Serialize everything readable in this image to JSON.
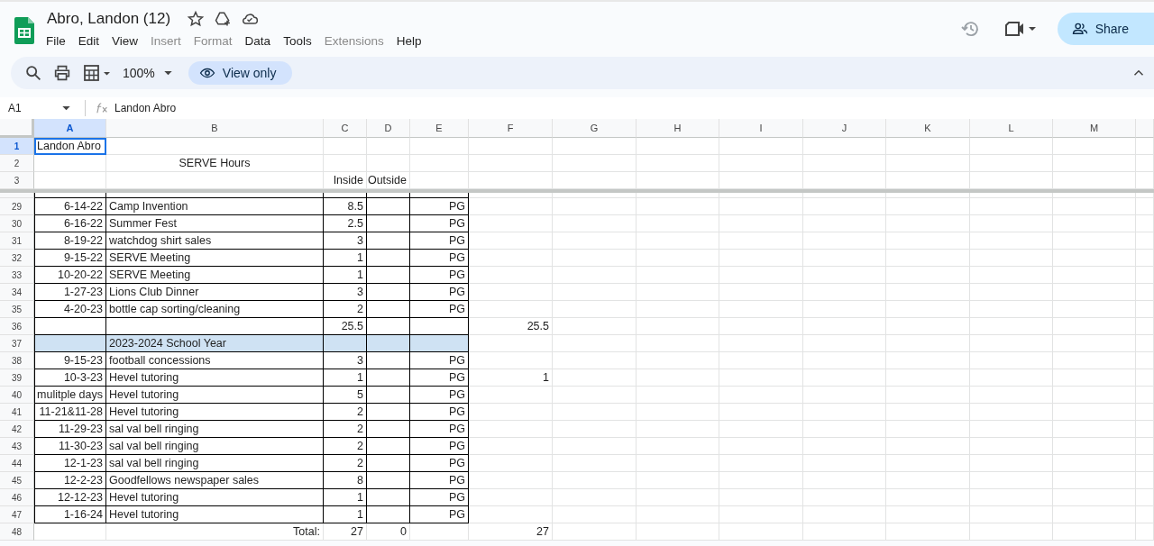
{
  "document": {
    "title": "Abro, Landon (12)"
  },
  "menus": [
    {
      "label": "File",
      "disabled": false
    },
    {
      "label": "Edit",
      "disabled": false
    },
    {
      "label": "View",
      "disabled": false
    },
    {
      "label": "Insert",
      "disabled": true
    },
    {
      "label": "Format",
      "disabled": true
    },
    {
      "label": "Data",
      "disabled": false
    },
    {
      "label": "Tools",
      "disabled": false
    },
    {
      "label": "Extensions",
      "disabled": true
    },
    {
      "label": "Help",
      "disabled": false
    }
  ],
  "share_button": {
    "label": "Share"
  },
  "toolbar": {
    "zoom": "100%",
    "mode": "View only"
  },
  "formula_bar": {
    "name_box": "A1",
    "value": "Landon Abro"
  },
  "columns": [
    {
      "label": "A",
      "selected": true
    },
    {
      "label": "B",
      "selected": false
    },
    {
      "label": "C",
      "selected": false
    },
    {
      "label": "D",
      "selected": false
    },
    {
      "label": "E",
      "selected": false
    },
    {
      "label": "F",
      "selected": false
    },
    {
      "label": "G",
      "selected": false
    },
    {
      "label": "H",
      "selected": false
    },
    {
      "label": "I",
      "selected": false
    },
    {
      "label": "J",
      "selected": false
    },
    {
      "label": "K",
      "selected": false
    },
    {
      "label": "L",
      "selected": false
    },
    {
      "label": "M",
      "selected": false
    }
  ],
  "frozen_rows": [
    {
      "number": "1",
      "selected": true,
      "kind": "title",
      "cells": {
        "A": "Landon Abro"
      }
    },
    {
      "number": "2",
      "selected": false,
      "kind": "heading",
      "cells": {
        "B": "SERVE Hours"
      }
    },
    {
      "number": "3",
      "selected": false,
      "kind": "plain",
      "cells": {
        "C": "Inside",
        "D": "Outside"
      }
    }
  ],
  "rows": [
    {
      "number": "29",
      "selected": false,
      "kind": "boxed",
      "cells": {
        "A": "6-14-22",
        "B": "Camp Invention",
        "C": "8.5",
        "E": "PG"
      }
    },
    {
      "number": "30",
      "selected": false,
      "kind": "boxed",
      "cells": {
        "A": "6-16-22",
        "B": "Summer Fest",
        "C": "2.5",
        "E": "PG"
      }
    },
    {
      "number": "31",
      "selected": false,
      "kind": "boxed",
      "cells": {
        "A": "8-19-22",
        "B": "watchdog shirt sales",
        "C": "3",
        "E": "PG"
      }
    },
    {
      "number": "32",
      "selected": false,
      "kind": "boxed",
      "cells": {
        "A": "9-15-22",
        "B": "SERVE Meeting",
        "C": "1",
        "E": "PG"
      }
    },
    {
      "number": "33",
      "selected": false,
      "kind": "boxed",
      "cells": {
        "A": "10-20-22",
        "B": "SERVE Meeting",
        "C": "1",
        "E": "PG"
      }
    },
    {
      "number": "34",
      "selected": false,
      "kind": "boxed",
      "cells": {
        "A": "1-27-23",
        "B": "Lions Club Dinner",
        "C": "3",
        "E": "PG"
      }
    },
    {
      "number": "35",
      "selected": false,
      "kind": "boxed",
      "cells": {
        "A": "4-20-23",
        "B": "bottle cap sorting/cleaning",
        "C": "2",
        "E": "PG"
      }
    },
    {
      "number": "36",
      "selected": false,
      "kind": "boxed",
      "cells": {
        "C": "25.5",
        "F": "25.5"
      }
    },
    {
      "number": "37",
      "selected": false,
      "kind": "section",
      "cells": {
        "B": "2023-2024 School Year"
      }
    },
    {
      "number": "38",
      "selected": false,
      "kind": "boxed",
      "cells": {
        "A": "9-15-23",
        "B": "football concessions",
        "C": "3",
        "E": "PG"
      }
    },
    {
      "number": "39",
      "selected": false,
      "kind": "boxed",
      "cells": {
        "A": "10-3-23",
        "B": "Hevel tutoring",
        "C": "1",
        "E": "PG",
        "F": "1"
      }
    },
    {
      "number": "40",
      "selected": false,
      "kind": "boxed",
      "cells": {
        "A": "mulitple days",
        "B": "Hevel tutoring",
        "C": "5",
        "E": "PG"
      }
    },
    {
      "number": "41",
      "selected": false,
      "kind": "boxed",
      "cells": {
        "A": "11-21&11-28",
        "B": "Hevel tutoring",
        "C": "2",
        "E": "PG"
      }
    },
    {
      "number": "42",
      "selected": false,
      "kind": "boxed",
      "cells": {
        "A": "11-29-23",
        "B": "sal val bell ringing",
        "C": "2",
        "E": "PG"
      }
    },
    {
      "number": "43",
      "selected": false,
      "kind": "boxed",
      "cells": {
        "A": "11-30-23",
        "B": "sal val bell ringing",
        "C": "2",
        "E": "PG"
      }
    },
    {
      "number": "44",
      "selected": false,
      "kind": "boxed",
      "cells": {
        "A": "12-1-23",
        "B": "sal val bell ringing",
        "C": "2",
        "E": "PG"
      }
    },
    {
      "number": "45",
      "selected": false,
      "kind": "boxed",
      "cells": {
        "A": "12-2-23",
        "B": "Goodfellows newspaper sales",
        "C": "8",
        "E": "PG"
      }
    },
    {
      "number": "46",
      "selected": false,
      "kind": "boxed",
      "cells": {
        "A": "12-12-23",
        "B": "Hevel tutoring",
        "C": "1",
        "E": "PG"
      }
    },
    {
      "number": "47",
      "selected": false,
      "kind": "boxed",
      "cells": {
        "A": "1-16-24",
        "B": "Hevel tutoring",
        "C": "1",
        "E": "PG"
      }
    },
    {
      "number": "48",
      "selected": false,
      "kind": "total",
      "cells": {
        "B": "Total:",
        "C": "27",
        "D": "0",
        "F": "27"
      }
    }
  ]
}
